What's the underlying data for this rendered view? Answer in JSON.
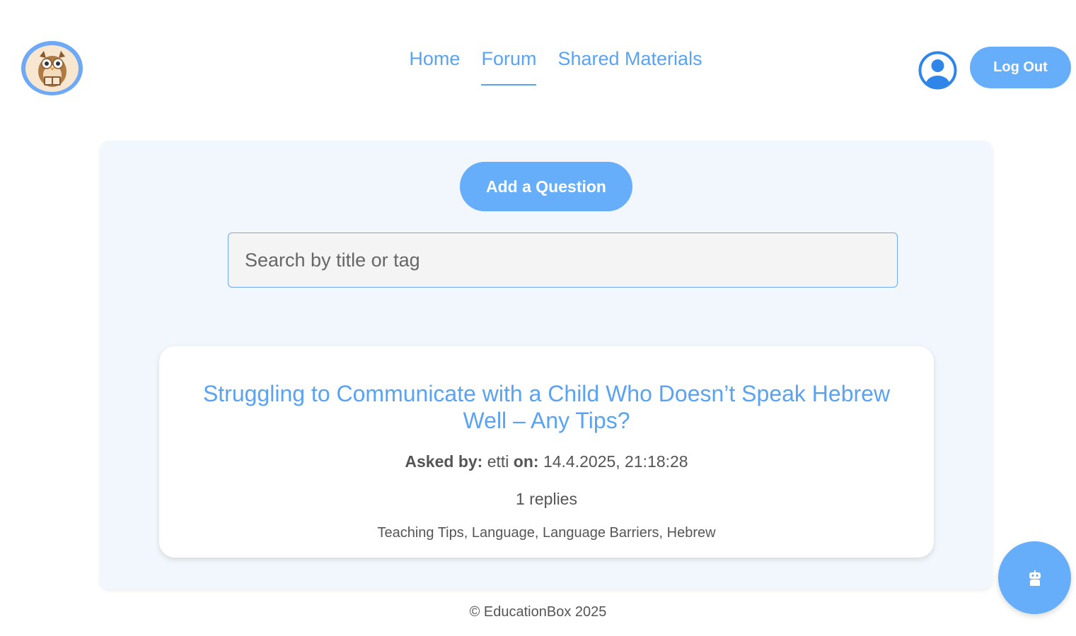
{
  "header": {
    "logo_icon": "owl-logo-icon",
    "nav": [
      {
        "label": "Home",
        "active": false
      },
      {
        "label": "Forum",
        "active": true
      },
      {
        "label": "Shared Materials",
        "active": false
      }
    ],
    "profile_icon": "user-circle-icon",
    "logout_label": "Log Out"
  },
  "forum": {
    "add_question_label": "Add a Question",
    "search_placeholder": "Search by title or tag",
    "posts": [
      {
        "title": "Struggling to Communicate with a Child Who Doesn’t Speak Hebrew Well – Any Tips?",
        "asked_by_label": "Asked by:",
        "author": "etti",
        "on_label": "on:",
        "date": "14.4.2025, 21:18:28",
        "replies": "1 replies",
        "tags": "Teaching Tips, Language, Language Barriers, Hebrew"
      }
    ]
  },
  "footer": {
    "text": "© EducationBox 2025"
  },
  "chatbot": {
    "icon": "robot-icon"
  },
  "colors": {
    "accent": "#66aef9",
    "link": "#5aa3f2",
    "panel_bg": "#f1f7fc"
  }
}
